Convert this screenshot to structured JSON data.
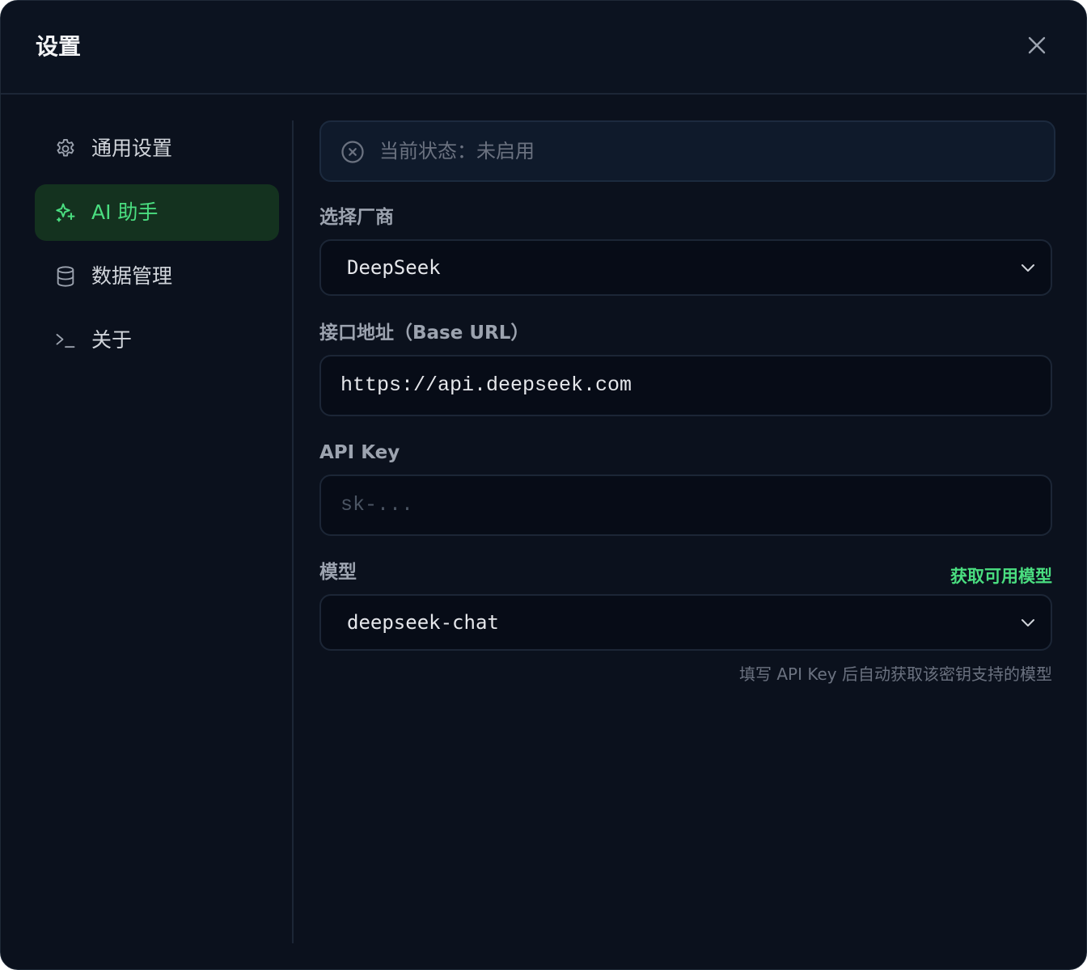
{
  "dialog": {
    "title": "设置",
    "close_icon": "close-icon"
  },
  "sidebar": {
    "items": [
      {
        "label": "通用设置",
        "icon": "gear-icon",
        "active": false
      },
      {
        "label": "AI 助手",
        "icon": "sparkles-icon",
        "active": true
      },
      {
        "label": "数据管理",
        "icon": "database-icon",
        "active": false
      },
      {
        "label": "关于",
        "icon": "terminal-icon",
        "active": false
      }
    ]
  },
  "status": {
    "icon": "circle-x-icon",
    "text": "当前状态：未启用"
  },
  "provider": {
    "label": "选择厂商",
    "value": "DeepSeek"
  },
  "base_url": {
    "label": "接口地址（Base URL）",
    "value": "https://api.deepseek.com"
  },
  "api_key": {
    "label": "API Key",
    "value": "",
    "placeholder": "sk-..."
  },
  "model": {
    "label": "模型",
    "fetch_link": "获取可用模型",
    "value": "deepseek-chat",
    "hint": "填写 API Key 后自动获取该密钥支持的模型"
  },
  "colors": {
    "accent": "#4ade80",
    "background": "#0b111d",
    "active_bg": "#14321f"
  }
}
